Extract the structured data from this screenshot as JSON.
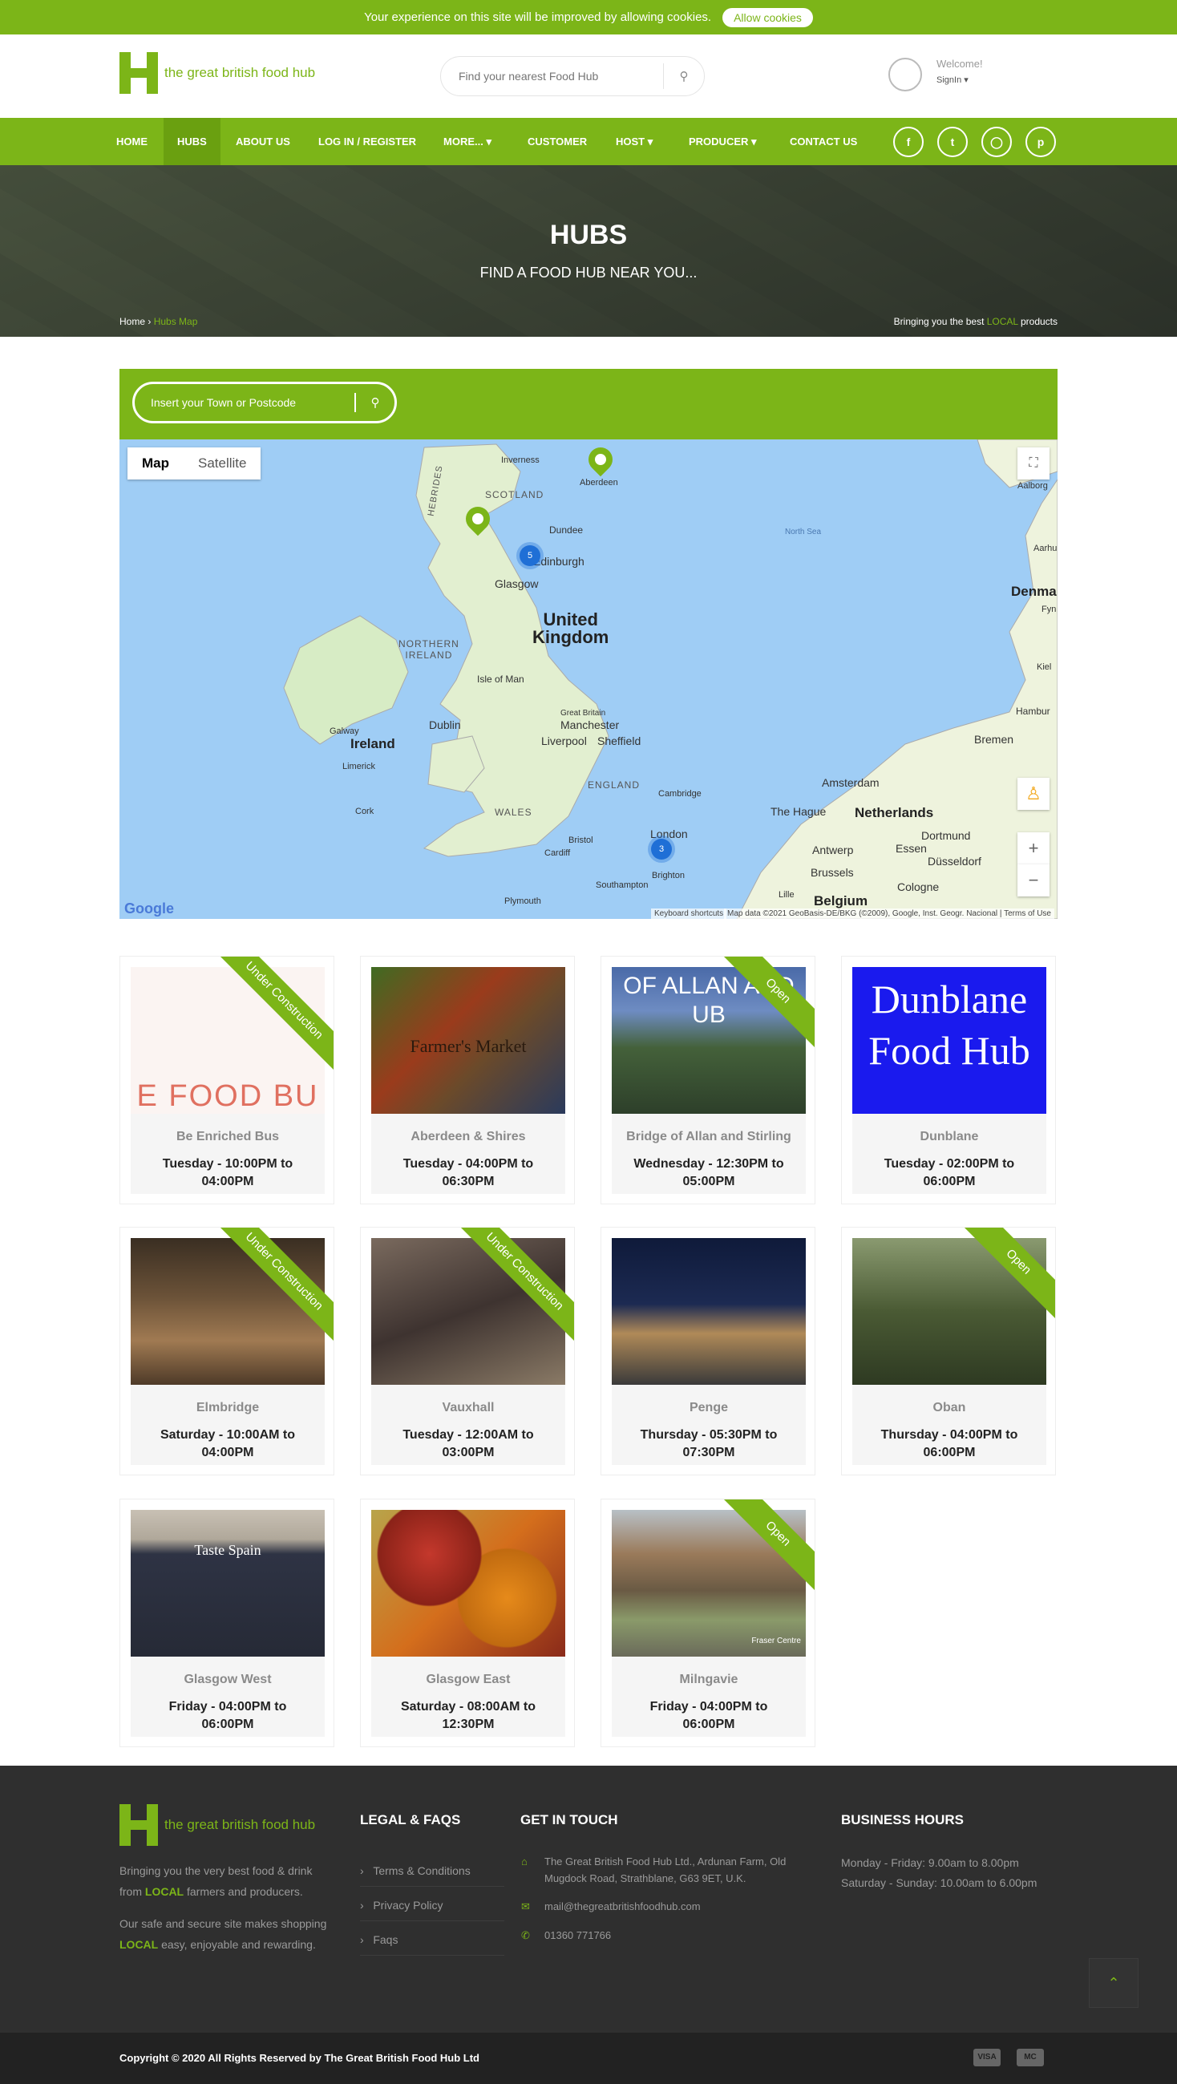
{
  "cookie": {
    "message": "Your experience on this site will be improved by allowing cookies.",
    "button": "Allow cookies"
  },
  "header": {
    "logo_text": "the great british food hub",
    "search_placeholder": "Find your nearest Food Hub",
    "welcome": "Welcome!",
    "signin": "SignIn ▾"
  },
  "nav": {
    "items": [
      "HOME",
      "HUBS",
      "ABOUT US",
      "LOG IN / REGISTER",
      "MORE... ▾",
      "CUSTOMER",
      "HOST ▾",
      "PRODUCER ▾",
      "CONTACT US"
    ],
    "active": "HUBS",
    "social": [
      "facebook-icon",
      "twitter-icon",
      "instagram-icon",
      "pinterest-icon"
    ]
  },
  "hero": {
    "title": "HUBS",
    "subtitle": "FIND A FOOD HUB NEAR YOU...",
    "breadcrumb_home": "Home",
    "breadcrumb_sep": "›",
    "breadcrumb_current": "Hubs Map",
    "tagline_pre": "Bringing you the best ",
    "tagline_local": "LOCAL",
    "tagline_post": " products"
  },
  "map_search": {
    "placeholder": "Insert your Town or Postcode"
  },
  "map": {
    "type_options": [
      "Map",
      "Satellite"
    ],
    "selected_type": "Map",
    "labels": {
      "scotland": "SCOTLAND",
      "uk": "United\nKingdom",
      "ni": "NORTHERN\nIRELAND",
      "ireland": "Ireland",
      "isle_of_man": "Isle of Man",
      "wales": "WALES",
      "england": "ENGLAND",
      "netherlands": "Netherlands",
      "north_sea": "North Sea",
      "hebrides": "HEBRIDES",
      "denmark": "Denma",
      "belgium": "Belgium",
      "inverness": "Inverness",
      "aberdeen": "Aberdeen",
      "dundee": "Dundee",
      "edinburgh": "Edinburgh",
      "glasgow": "Glasgow",
      "dublin": "Dublin",
      "galway": "Galway",
      "limerick": "Limerick",
      "cork": "Cork",
      "manchester": "Manchester",
      "great_britain": "Great Britain",
      "liverpool": "Liverpool",
      "sheffield": "Sheffield",
      "cambridge": "Cambridge",
      "london": "London",
      "bristol": "Bristol",
      "cardiff": "Cardiff",
      "southampton": "Southampton",
      "brighton": "Brighton",
      "plymouth": "Plymouth",
      "amsterdam": "Amsterdam",
      "the_hague": "The Hague",
      "antwerp": "Antwerp",
      "brussels": "Brussels",
      "essen": "Essen",
      "dortmund": "Dortmund",
      "dusseldorf": "Düsseldorf",
      "cologne": "Cologne",
      "lille": "Lille",
      "bremen": "Bremen",
      "hamburg": "Hambur",
      "aalborg": "Aalborg",
      "aarhus": "Aarhu",
      "kiel": "Kiel",
      "fyn": "Fyn"
    },
    "clusters": [
      "5",
      "3"
    ],
    "keyboard": "Keyboard shortcuts",
    "attribution": "Map data ©2021 GeoBasis-DE/BKG (©2009), Google, Inst. Geogr. Nacional | Terms of Use",
    "google": "Google"
  },
  "hubs": [
    {
      "name": "Be Enriched Bus",
      "time": "Tuesday - 10:00PM to 04:00PM",
      "badge": "Under Construction",
      "img_text": "E FOOD BU",
      "img": "carrots"
    },
    {
      "name": "Aberdeen & Shires",
      "time": "Tuesday - 04:00PM to 06:30PM",
      "badge": "",
      "img_text": "Farmer's Market",
      "img": "market"
    },
    {
      "name": "Bridge of Allan and Stirling",
      "time": "Wednesday - 12:30PM to 05:00PM",
      "badge": "Open",
      "img_text": "OF ALLAN AND UB",
      "img": "castle"
    },
    {
      "name": "Dunblane",
      "time": "Tuesday - 02:00PM to 06:00PM",
      "badge": "",
      "img_text": "Dunblane Food Hub",
      "img": "blue"
    },
    {
      "name": "Elmbridge",
      "time": "Saturday - 10:00AM to 04:00PM",
      "badge": "Under Construction",
      "img_text": "",
      "img": "jars"
    },
    {
      "name": "Vauxhall",
      "time": "Tuesday - 12:00AM to 03:00PM",
      "badge": "Under Construction",
      "img_text": "",
      "img": "people"
    },
    {
      "name": "Penge",
      "time": "Thursday - 05:30PM to 07:30PM",
      "badge": "",
      "img_text": "",
      "img": "pub"
    },
    {
      "name": "Oban",
      "time": "Thursday - 04:00PM to 06:00PM",
      "badge": "Open",
      "img_text": "",
      "img": "trees"
    },
    {
      "name": "Glasgow West",
      "time": "Friday - 04:00PM to 06:00PM",
      "badge": "",
      "img_text": "Taste Spain",
      "img": "shop"
    },
    {
      "name": "Glasgow East",
      "time": "Saturday - 08:00AM to 12:30PM",
      "badge": "",
      "img_text": "",
      "img": "fruit"
    },
    {
      "name": "Milngavie",
      "time": "Friday - 04:00PM to 06:00PM",
      "badge": "Open",
      "img_text": "Fraser Centre",
      "img": "garden"
    }
  ],
  "footer": {
    "logo_text": "the great british food hub",
    "about1_pre": "Bringing you the very best food & drink from ",
    "about1_local": "LOCAL",
    "about1_post": " farmers and producers.",
    "about2_pre": "Our safe and secure site makes shopping ",
    "about2_local": "LOCAL",
    "about2_post": " easy, enjoyable and rewarding.",
    "legal_title": "LEGAL & FAQS",
    "legal_links": [
      "Terms & Conditions",
      "Privacy Policy",
      "Faqs"
    ],
    "contact_title": "GET IN TOUCH",
    "address": "The Great British Food Hub Ltd., Ardunan Farm, Old Mugdock Road, Strathblane, G63 9ET, U.K.",
    "email": "mail@thegreatbritishfoodhub.com",
    "phone": "01360 771766",
    "hours_title": "BUSINESS HOURS",
    "hours": [
      "Monday - Friday: 9.00am to 8.00pm",
      "Saturday - Sunday: 10.00am to 6.00pm"
    ],
    "copyright": "Copyright © 2020 All Rights Reserved by The Great British Food Hub Ltd",
    "payments": [
      "VISA",
      "MC"
    ]
  },
  "colors": {
    "brand": "#7cb518",
    "dark": "#2f2f2f"
  }
}
